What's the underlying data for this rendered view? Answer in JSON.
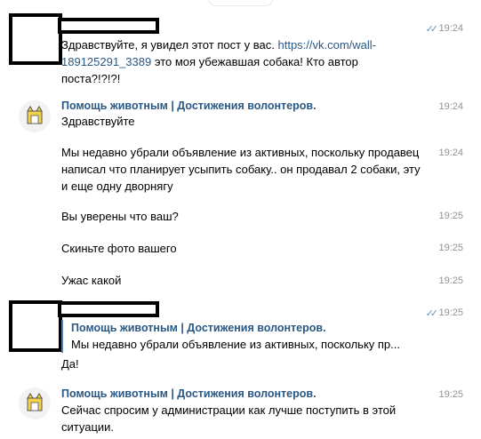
{
  "messages": [
    {
      "text_before_link": "Здравствуйте, я увидел этот пост у вас. ",
      "link_line1": "https://vk.com/wall-",
      "link_line2": "189125291_3389",
      "text_after_link": " это моя убежавшая собака! Кто автор",
      "text_line3": "поста?!?!?!",
      "time": "19:24"
    },
    {
      "author": "Помощь животным | Достижения волонтеров.",
      "text": "Здравствуйте",
      "time": "19:24"
    },
    {
      "line1": "Мы недавно убрали объявление из активных, поскольку продавец",
      "line2": "написал что планирует усыпить собаку.. он продавал 2 собаки, эту",
      "line3": "и еще одну дворнягу",
      "time": "19:24"
    },
    {
      "text": "Вы уверены что ваш?",
      "time": "19:25"
    },
    {
      "text": "Скиньте фото вашего",
      "time": "19:25"
    },
    {
      "text": "Ужас какой",
      "time": "19:25"
    },
    {
      "quote_author": "Помощь животным | Достижения волонтеров.",
      "quote_text": "Мы недавно убрали объявление из активных, поскольку пр...",
      "text": "Да!",
      "time": "19:25"
    },
    {
      "author": "Помощь животным | Достижения волонтеров.",
      "line1": "Сейчас спросим у администрации как лучше поступить в этой",
      "line2": "ситуации.",
      "time": "19:25"
    }
  ],
  "icons": {
    "read_status": "double-check-icon",
    "org_avatar": "cat-avatar-icon"
  },
  "colors": {
    "link": "#2a5885",
    "time": "#939393",
    "quote_bar": "#5181b8",
    "read": "#6d8fb3"
  }
}
